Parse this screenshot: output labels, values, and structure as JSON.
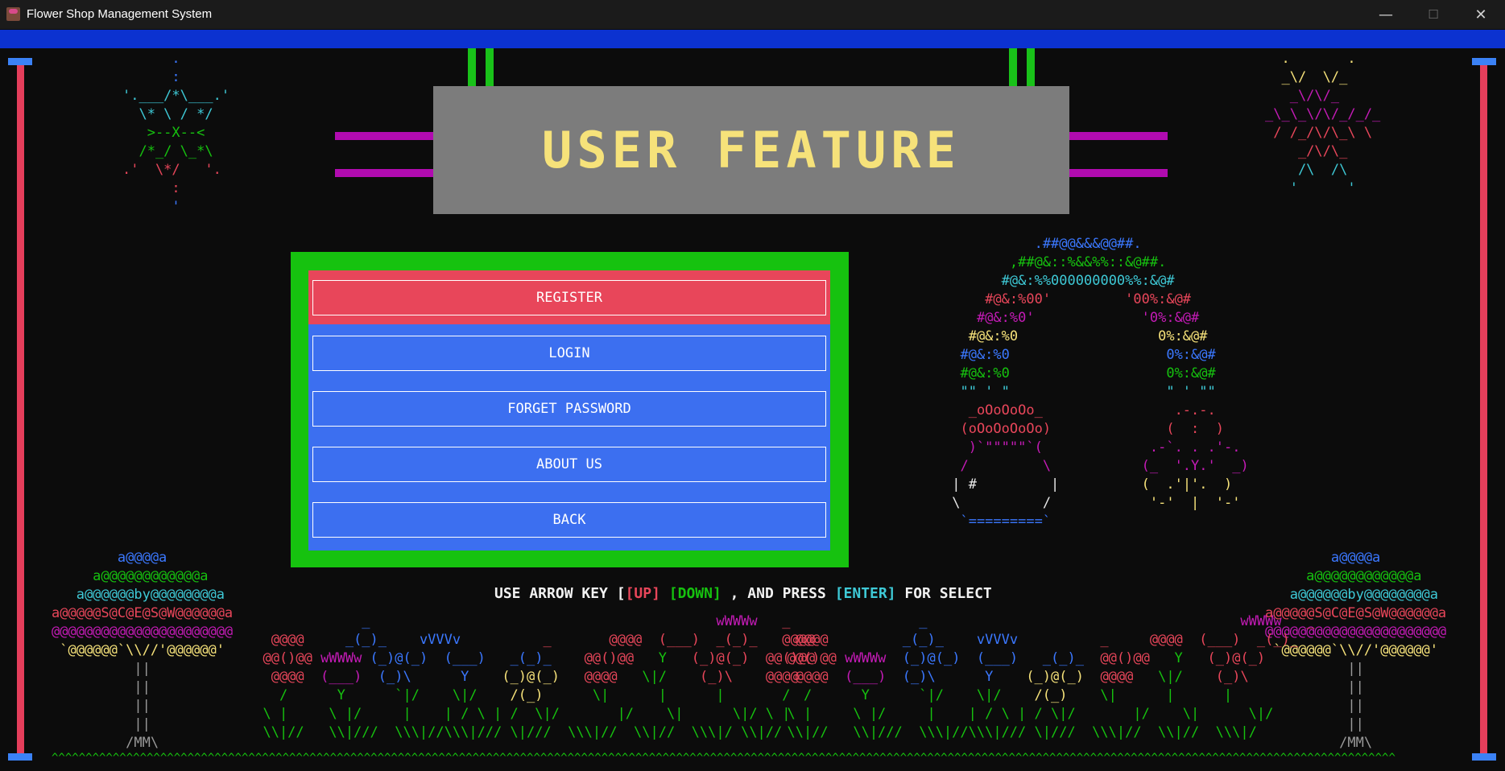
{
  "window": {
    "title": "Flower Shop Management System",
    "minimize_glyph": "—",
    "maximize_glyph": "☐",
    "close_glyph": "✕"
  },
  "header": {
    "title": "USER FEATURE"
  },
  "menu": {
    "items": [
      {
        "label": "REGISTER",
        "selected": true
      },
      {
        "label": "LOGIN"
      },
      {
        "label": "FORGET PASSWORD"
      },
      {
        "label": "ABOUT US"
      },
      {
        "label": "BACK"
      }
    ]
  },
  "instruction": {
    "part1": "USE ARROW KEY [",
    "up": "[UP]",
    "down": "[DOWN]",
    "part2": " , AND PRESS ",
    "enter": "[ENTER]",
    "part3": " FOR SELECT"
  },
  "colors": {
    "banner": "#0c32d0",
    "menu_frame": "#16c20f",
    "menu_button": "#3c6ff0",
    "selected_button": "#e8465a",
    "sign": "#7c7c7c",
    "title_text": "#f6e27a"
  },
  "icons": {
    "app": "flower-shop-app-icon",
    "minimize": "minimize-icon",
    "maximize": "maximize-icon",
    "close": "close-icon"
  }
}
